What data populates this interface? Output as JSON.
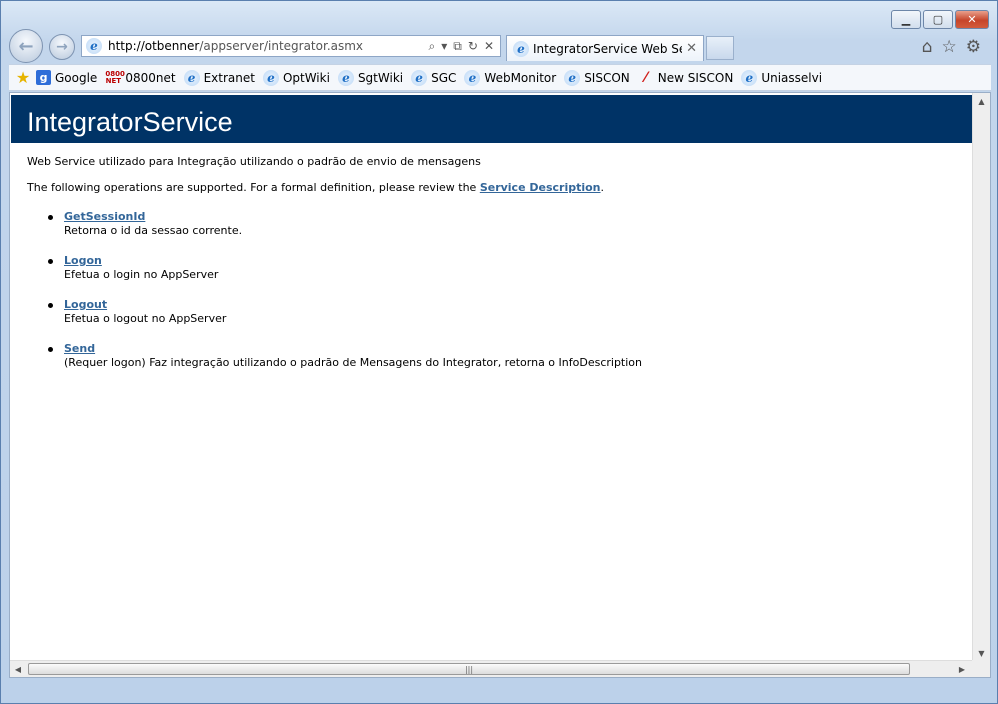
{
  "window": {
    "minimize_glyph": "▁",
    "maximize_glyph": "▢",
    "close_glyph": "✕"
  },
  "nav": {
    "back_glyph": "←",
    "forward_glyph": "→",
    "address": {
      "host": "http://otbenner",
      "path": "/appserver/integrator.asmx"
    },
    "tools": [
      "⌕",
      "▾",
      "⧉",
      "↻",
      "✕"
    ]
  },
  "tab": {
    "title": "IntegratorService Web Servi...",
    "close_glyph": "✕"
  },
  "toolbar_right": [
    "⌂",
    "☆",
    "⚙"
  ],
  "favorites": {
    "star_glyph": "★",
    "items": [
      {
        "label": "Google",
        "icon": "google-icon"
      },
      {
        "label": "0800net",
        "icon": "0800net-icon"
      },
      {
        "label": "Extranet",
        "icon": "ie-page-icon"
      },
      {
        "label": "OptWiki",
        "icon": "ie-page-icon"
      },
      {
        "label": "SgtWiki",
        "icon": "ie-page-icon"
      },
      {
        "label": "SGC",
        "icon": "ie-page-icon"
      },
      {
        "label": "WebMonitor",
        "icon": "ie-page-icon"
      },
      {
        "label": "SISCON",
        "icon": "ie-page-icon"
      },
      {
        "label": "New SISCON",
        "icon": "siscon-icon"
      },
      {
        "label": "Uniasselvi",
        "icon": "ie-page-icon"
      }
    ]
  },
  "page": {
    "title": "IntegratorService",
    "description": "Web Service utilizado para Integração utilizando o padrão de envio de mensagens",
    "intro_prefix": "The following operations are supported. For a formal definition, please review the ",
    "intro_link": "Service Description",
    "intro_suffix": ".",
    "operations": [
      {
        "name": "GetSessionId",
        "description": "Retorna o id da sessao corrente."
      },
      {
        "name": "Logon",
        "description": "Efetua o login no AppServer"
      },
      {
        "name": "Logout",
        "description": "Efetua o logout no AppServer"
      },
      {
        "name": "Send",
        "description": "(Requer logon) Faz integração utilizando o padrão de Mensagens do Integrator, retorna o InfoDescription"
      }
    ]
  },
  "colors": {
    "header_bg": "#003366",
    "link": "#336699"
  }
}
